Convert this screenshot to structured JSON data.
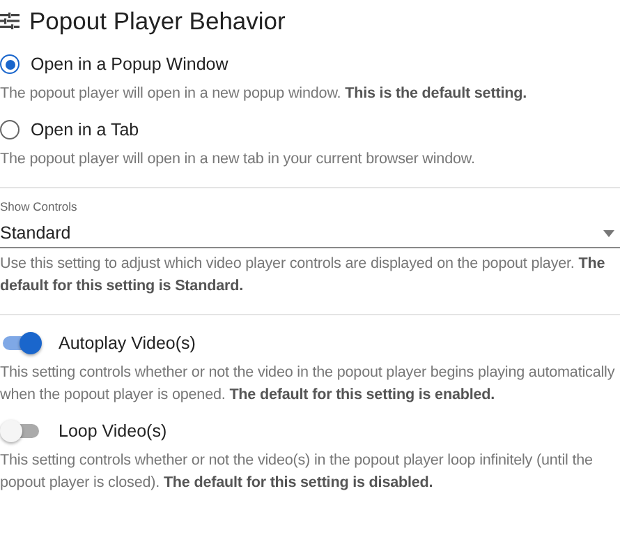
{
  "header": {
    "title": "Popout Player Behavior"
  },
  "sections": [
    {
      "kind": "radio",
      "options": [
        {
          "label": "Open in a Popup Window",
          "selected": true,
          "help": "The popout player will open in a new popup window. **This is the default setting.**"
        },
        {
          "label": "Open in a Tab",
          "selected": false,
          "help": "The popout player will open in a new tab in your current browser window."
        }
      ]
    },
    {
      "kind": "select",
      "label": "Show Controls",
      "value": "Standard",
      "help": "Use this setting to adjust which video player controls are displayed on the popout player. **The default for this setting is Standard.**"
    },
    {
      "kind": "toggles",
      "items": [
        {
          "label": "Autoplay Video(s)",
          "on": true,
          "help": "This setting controls whether or not the video in the popout player begins playing automatically when the popout player is opened. **The default for this setting is enabled.**"
        },
        {
          "label": "Loop Video(s)",
          "on": false,
          "help": "This setting controls whether or not the video(s) in the popout player loop infinitely (until the popout player is closed). **The default for this setting is disabled.**"
        }
      ]
    }
  ]
}
